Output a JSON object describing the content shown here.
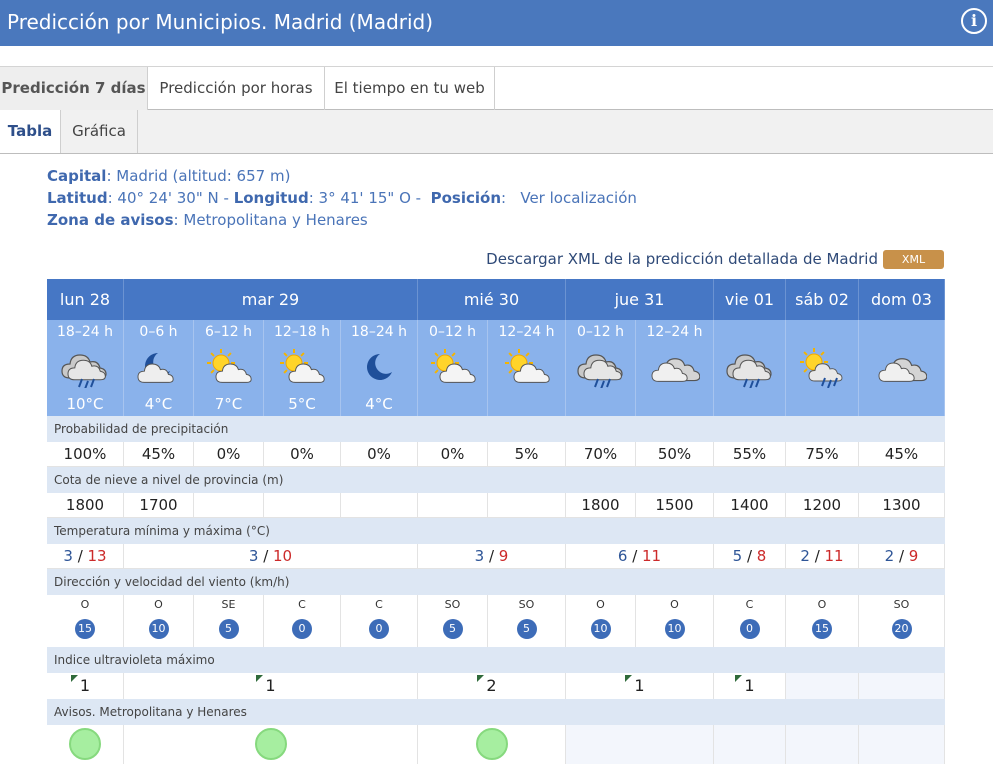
{
  "header": {
    "title": "Predicción por Municipios. Madrid (Madrid)"
  },
  "tabs_primary": [
    "Predicción 7 días",
    "Predicción por horas",
    "El tiempo en tu web"
  ],
  "tabs_secondary": [
    "Tabla",
    "Gráfica"
  ],
  "location": {
    "capital_label": "Capital",
    "capital_value": "Madrid (altitud: 657 m)",
    "lat_label": "Latitud",
    "lat_value": "40° 24' 30\" N",
    "lon_label": "Longitud",
    "lon_value": "3° 41' 15\" O",
    "pos_label": "Posición",
    "pos_link": "Ver localización",
    "zona_label": "Zona de avisos",
    "zona_value": "Metropolitana y Henares"
  },
  "xml": {
    "text": "Descargar XML de la predicción detallada de Madrid",
    "button": "XML"
  },
  "days": [
    "lun 28",
    "mar 29",
    "mié 30",
    "jue 31",
    "vie 01",
    "sáb 02",
    "dom 03"
  ],
  "periods": [
    {
      "label": "18–24 h",
      "icon": "cloud-rain-icon",
      "temp": "10°C"
    },
    {
      "label": "0–6 h",
      "icon": "moon-cloud-icon",
      "temp": "4°C"
    },
    {
      "label": "6–12 h",
      "icon": "sun-cloud-icon",
      "temp": "7°C"
    },
    {
      "label": "12–18 h",
      "icon": "sun-cloud-icon",
      "temp": "5°C"
    },
    {
      "label": "18–24 h",
      "icon": "moon-icon",
      "temp": "4°C"
    },
    {
      "label": "0–12 h",
      "icon": "sun-cloud-icon",
      "temp": ""
    },
    {
      "label": "12–24 h",
      "icon": "sun-cloud-icon",
      "temp": ""
    },
    {
      "label": "0–12 h",
      "icon": "cloud-rain-icon",
      "temp": ""
    },
    {
      "label": "12–24 h",
      "icon": "cloud-icon",
      "temp": ""
    },
    {
      "label": "",
      "icon": "cloud-rain-icon",
      "temp": ""
    },
    {
      "label": "",
      "icon": "sun-cloud-rain-icon",
      "temp": ""
    },
    {
      "label": "",
      "icon": "cloud-icon",
      "temp": ""
    }
  ],
  "labels": {
    "precip": "Probabilidad de precipitación",
    "snow": "Cota de nieve a nivel de provincia (m)",
    "temp": "Temperatura mínima y máxima (°C)",
    "wind": "Dirección y velocidad del viento (km/h)",
    "uv": "Indice ultravioleta máximo",
    "warnings": "Avisos. Metropolitana y Henares"
  },
  "precip": [
    "100%",
    "45%",
    "0%",
    "0%",
    "0%",
    "0%",
    "5%",
    "70%",
    "50%",
    "55%",
    "75%",
    "45%"
  ],
  "snow": [
    "1800",
    "1700",
    "",
    "",
    "",
    "",
    "",
    "1800",
    "1500",
    "1400",
    "1200",
    "1300"
  ],
  "temps": [
    {
      "min": "3",
      "max": "13"
    },
    {
      "min": "3",
      "max": "10"
    },
    {
      "min": "3",
      "max": "9"
    },
    {
      "min": "6",
      "max": "11"
    },
    {
      "min": "5",
      "max": "8"
    },
    {
      "min": "2",
      "max": "11"
    },
    {
      "min": "2",
      "max": "9"
    }
  ],
  "wind": [
    {
      "dir": "O",
      "speed": "15"
    },
    {
      "dir": "O",
      "speed": "10"
    },
    {
      "dir": "SE",
      "speed": "5"
    },
    {
      "dir": "C",
      "speed": "0"
    },
    {
      "dir": "C",
      "speed": "0"
    },
    {
      "dir": "SO",
      "speed": "5"
    },
    {
      "dir": "SO",
      "speed": "5"
    },
    {
      "dir": "O",
      "speed": "10"
    },
    {
      "dir": "O",
      "speed": "10"
    },
    {
      "dir": "C",
      "speed": "0"
    },
    {
      "dir": "O",
      "speed": "15"
    },
    {
      "dir": "SO",
      "speed": "20"
    }
  ],
  "uv": [
    "1",
    "1",
    "2",
    "1",
    "1",
    "",
    ""
  ],
  "colors": {
    "header": "#4a78bd",
    "days": "#4677c5",
    "icons": "#8ab2eb",
    "temp_min": "#2e5597",
    "temp_max": "#cc2a2a",
    "warn_green": "#a6eea0"
  }
}
